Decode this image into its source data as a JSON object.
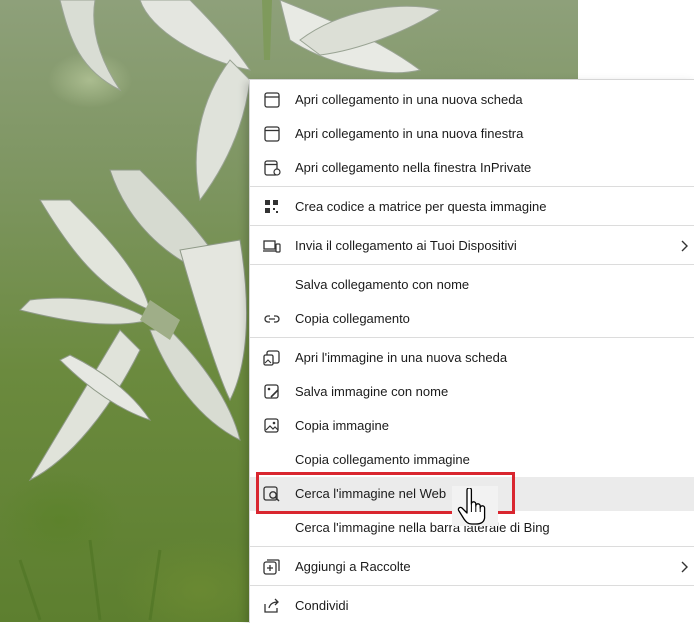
{
  "menu": {
    "items": [
      {
        "label": "Apri collegamento in una nuova scheda",
        "icon": "new-tab-icon",
        "submenu": false
      },
      {
        "label": "Apri collegamento in una nuova finestra",
        "icon": "new-window-icon",
        "submenu": false
      },
      {
        "label": "Apri collegamento nella finestra InPrivate",
        "icon": "inprivate-window-icon",
        "submenu": false
      },
      {
        "label": "Crea codice a matrice per questa immagine",
        "icon": "qr-code-icon",
        "submenu": false
      },
      {
        "label": "Invia il collegamento ai Tuoi Dispositivi",
        "icon": "devices-icon",
        "submenu": true
      },
      {
        "label": "Salva collegamento con nome",
        "icon": "",
        "submenu": false
      },
      {
        "label": "Copia collegamento",
        "icon": "link-icon",
        "submenu": false
      },
      {
        "label": "Apri l'immagine in una nuova scheda",
        "icon": "image-new-tab-icon",
        "submenu": false
      },
      {
        "label": "Salva immagine con nome",
        "icon": "save-image-icon",
        "submenu": false
      },
      {
        "label": "Copia immagine",
        "icon": "image-icon",
        "submenu": false
      },
      {
        "label": "Copia collegamento immagine",
        "icon": "",
        "submenu": false
      },
      {
        "label": "Cerca l'immagine nel Web",
        "icon": "visual-search-icon",
        "submenu": false,
        "hovered": true
      },
      {
        "label": "Cerca l'immagine nella barra laterale di Bing",
        "icon": "",
        "submenu": false
      },
      {
        "label": "Aggiungi a Raccolte",
        "icon": "collections-icon",
        "submenu": true
      },
      {
        "label": "Condividi",
        "icon": "share-icon",
        "submenu": false
      }
    ]
  },
  "colors": {
    "highlight_border": "#d9262f",
    "menu_bg": "#ffffff",
    "hover_bg": "#ebebeb"
  }
}
